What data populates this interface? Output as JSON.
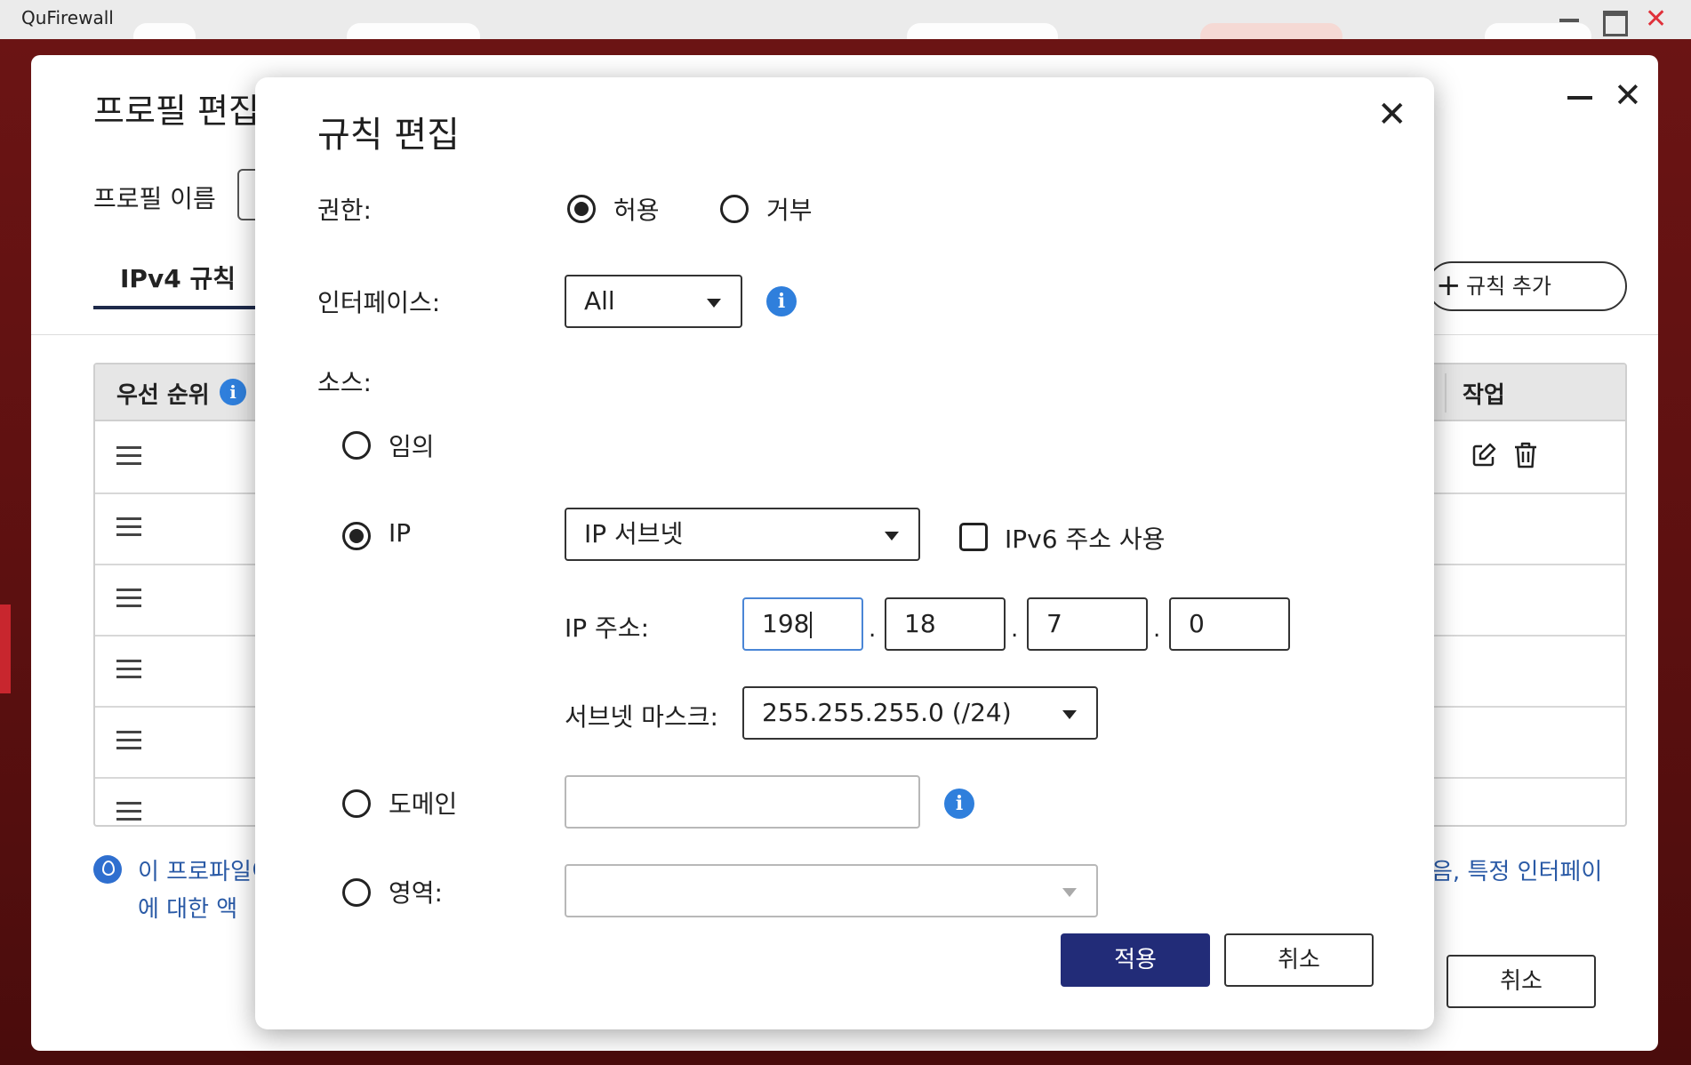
{
  "app": {
    "title": "QuFirewall"
  },
  "background_window": {
    "title": "프로필 편집",
    "profile_name_label": "프로필 이름",
    "tab_ipv4": "IPv4 규칙",
    "add_rule_button": "규칙 추가",
    "table": {
      "header_priority": "우선 순위",
      "header_action": "작업",
      "row_count": 6
    },
    "hint_left": "이 프로파일이 스에 대한 액",
    "hint_right": "음, 특정 인터페이",
    "cancel_button": "취소"
  },
  "modal": {
    "title": "규칙 편집",
    "permission": {
      "label": "권한:",
      "options": [
        {
          "label": "허용",
          "checked": true
        },
        {
          "label": "거부",
          "checked": false
        }
      ]
    },
    "interface": {
      "label": "인터페이스:",
      "selected": "All"
    },
    "source": {
      "label": "소스:",
      "any": {
        "label": "임의",
        "checked": false
      },
      "ip": {
        "label": "IP",
        "checked": true,
        "type_selected": "IP 서브넷",
        "ipv6_checkbox_label": "IPv6 주소 사용",
        "ipv6_checked": false,
        "address_label": "IP 주소:",
        "octets": [
          "198",
          "18",
          "7",
          "0"
        ],
        "subnet_label": "서브넷 마스크:",
        "subnet_selected": "255.255.255.0 (/24)"
      },
      "domain": {
        "label": "도메인",
        "checked": false,
        "value": ""
      },
      "region": {
        "label": "영역:",
        "checked": false,
        "value": ""
      }
    },
    "apply_button": "적용",
    "cancel_button": "취소"
  },
  "colors": {
    "primary_button": "#222c78",
    "info_icon": "#2f7fdc",
    "close_icon": "#e0303a",
    "hint_text": "#2a5aa6"
  }
}
